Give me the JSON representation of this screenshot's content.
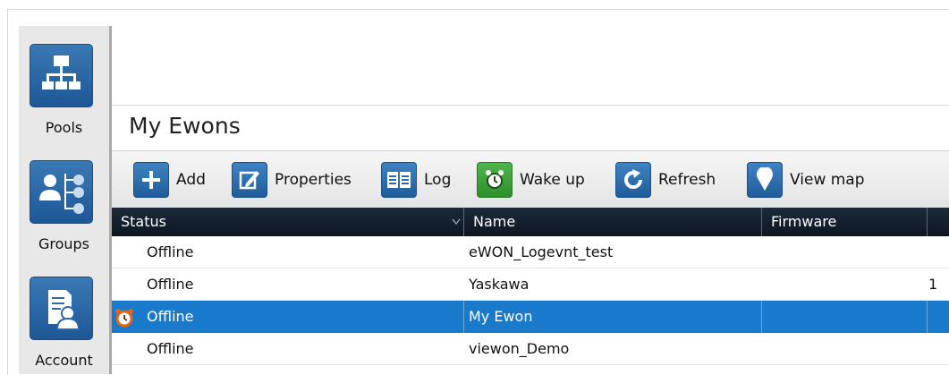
{
  "nav": {
    "items": [
      {
        "label": "Pools",
        "icon": "hierarchy-icon"
      },
      {
        "label": "Groups",
        "icon": "groups-icon"
      },
      {
        "label": "Account",
        "icon": "account-icon"
      }
    ]
  },
  "header": {
    "title": "My Ewons"
  },
  "toolbar": {
    "buttons": [
      {
        "label": "Add",
        "icon": "plus-icon"
      },
      {
        "label": "Properties",
        "icon": "edit-icon"
      },
      {
        "label": "Log",
        "icon": "book-icon"
      },
      {
        "label": "Wake up",
        "icon": "alarm-clock-icon"
      },
      {
        "label": "Refresh",
        "icon": "refresh-icon"
      },
      {
        "label": "View map",
        "icon": "map-pin-icon"
      }
    ]
  },
  "table": {
    "columns": [
      "Status",
      "Name",
      "Firmware"
    ],
    "rows": [
      {
        "status": "Offline",
        "name": "eWON_Logevnt_test",
        "firmware": ""
      },
      {
        "status": "Offline",
        "name": "Yaskawa",
        "firmware": "",
        "extra": "1"
      },
      {
        "status": "Offline",
        "name": "My Ewon",
        "firmware": "",
        "selected": true,
        "alarm": true
      },
      {
        "status": "Offline",
        "name": "viewon_Demo",
        "firmware": ""
      }
    ]
  },
  "colors": {
    "accent": "#1979ca",
    "icon_blue": "#2a6aab",
    "icon_green": "#3aa537",
    "header_dark": "#101b28",
    "rail": "#e8e8e8"
  }
}
